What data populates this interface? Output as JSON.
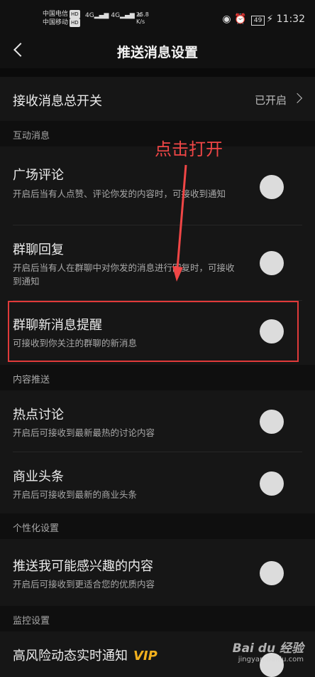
{
  "status_bar": {
    "carrier1": "中国电信",
    "carrier2": "中国移动",
    "hd": "HD",
    "signal1": "4G",
    "signal2": "4G",
    "speed_value": "25.8",
    "speed_unit": "K/s",
    "battery": "49",
    "time": "11:32"
  },
  "nav": {
    "title": "推送消息设置"
  },
  "master": {
    "label": "接收消息总开关",
    "status": "已开启"
  },
  "sections": {
    "interaction": "互动消息",
    "content": "内容推送",
    "personalized": "个性化设置",
    "monitor": "监控设置"
  },
  "items": [
    {
      "title": "广场评论",
      "desc": "开启后当有人点赞、评论你发的内容时，可接收到通知",
      "enabled": false
    },
    {
      "title": "群聊回复",
      "desc": "开启后当有人在群聊中对你发的消息进行回复时，可接收到通知",
      "enabled": false
    },
    {
      "title": "群聊新消息提醒",
      "desc": "可接收到你关注的群聊的新消息",
      "enabled": false
    },
    {
      "title": "热点讨论",
      "desc": "开启后可接收到最新最热的讨论内容",
      "enabled": false
    },
    {
      "title": "商业头条",
      "desc": "开启后可接收到最新的商业头条",
      "enabled": false
    },
    {
      "title": "推送我可能感兴趣的内容",
      "desc": "开启后可接收到更适合您的优质内容",
      "enabled": false
    },
    {
      "title": "高风险动态实时通知",
      "badge": "VIP",
      "enabled": false
    }
  ],
  "annotation": {
    "text": "点击打开",
    "color": "#f04646"
  },
  "watermark": {
    "logo": "Bai du 经验",
    "url": "jingyan.baidu.com"
  },
  "colors": {
    "background": "#161616",
    "toggle_off": "#dcdcdc",
    "highlight": "#e03a3a",
    "vip": "#f2b01e"
  }
}
